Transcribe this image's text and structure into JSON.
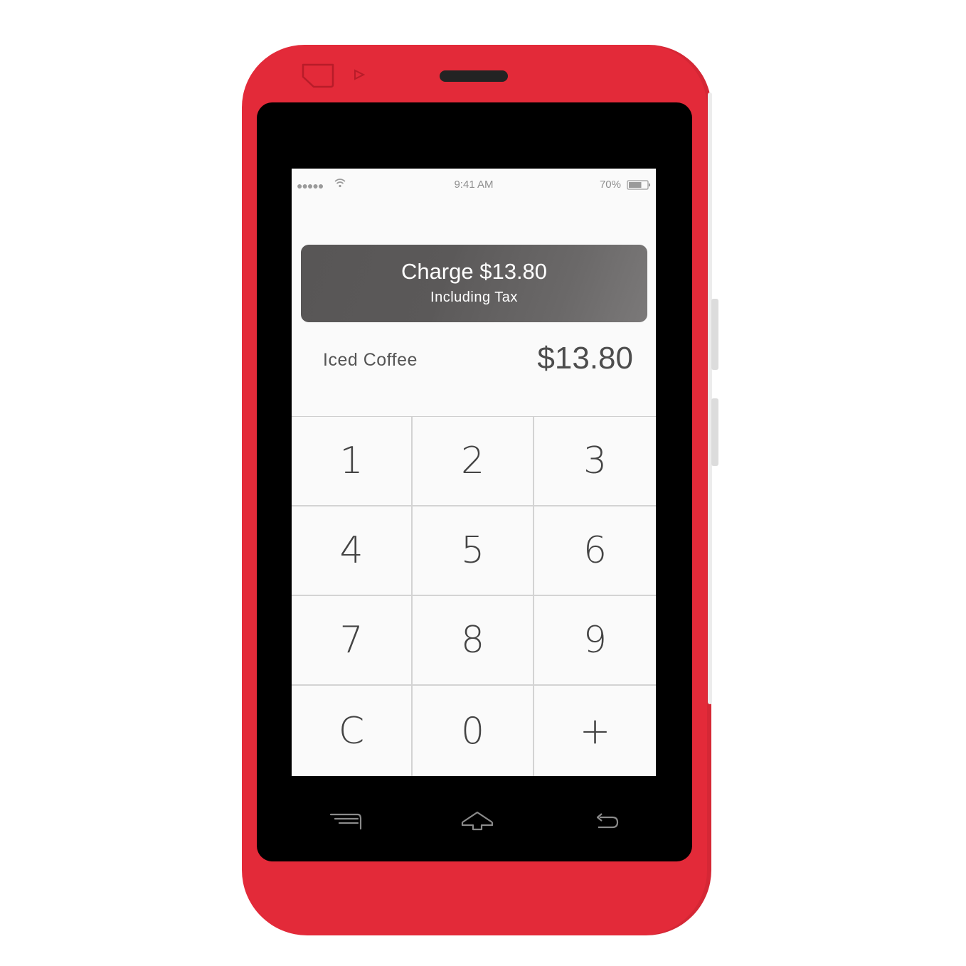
{
  "status_bar": {
    "signal": "●●●●●",
    "time": "9:41 AM",
    "battery_percent": "70%",
    "battery_level": 0.7
  },
  "charge_button": {
    "title": "Charge $13.80",
    "subtitle": "Including Tax"
  },
  "line_item": {
    "name": "Iced Coffee",
    "price": "$13.80"
  },
  "keypad": {
    "keys": [
      "1",
      "2",
      "3",
      "4",
      "5",
      "6",
      "7",
      "8",
      "9",
      "C",
      "0",
      "+"
    ]
  },
  "nav": {
    "icons": [
      "menu-icon",
      "home-icon",
      "back-icon"
    ]
  },
  "colors": {
    "device_body": "#e32a39",
    "bezel": "#000000",
    "screen_bg": "#fafafa",
    "charge_button": "#5b5959"
  }
}
